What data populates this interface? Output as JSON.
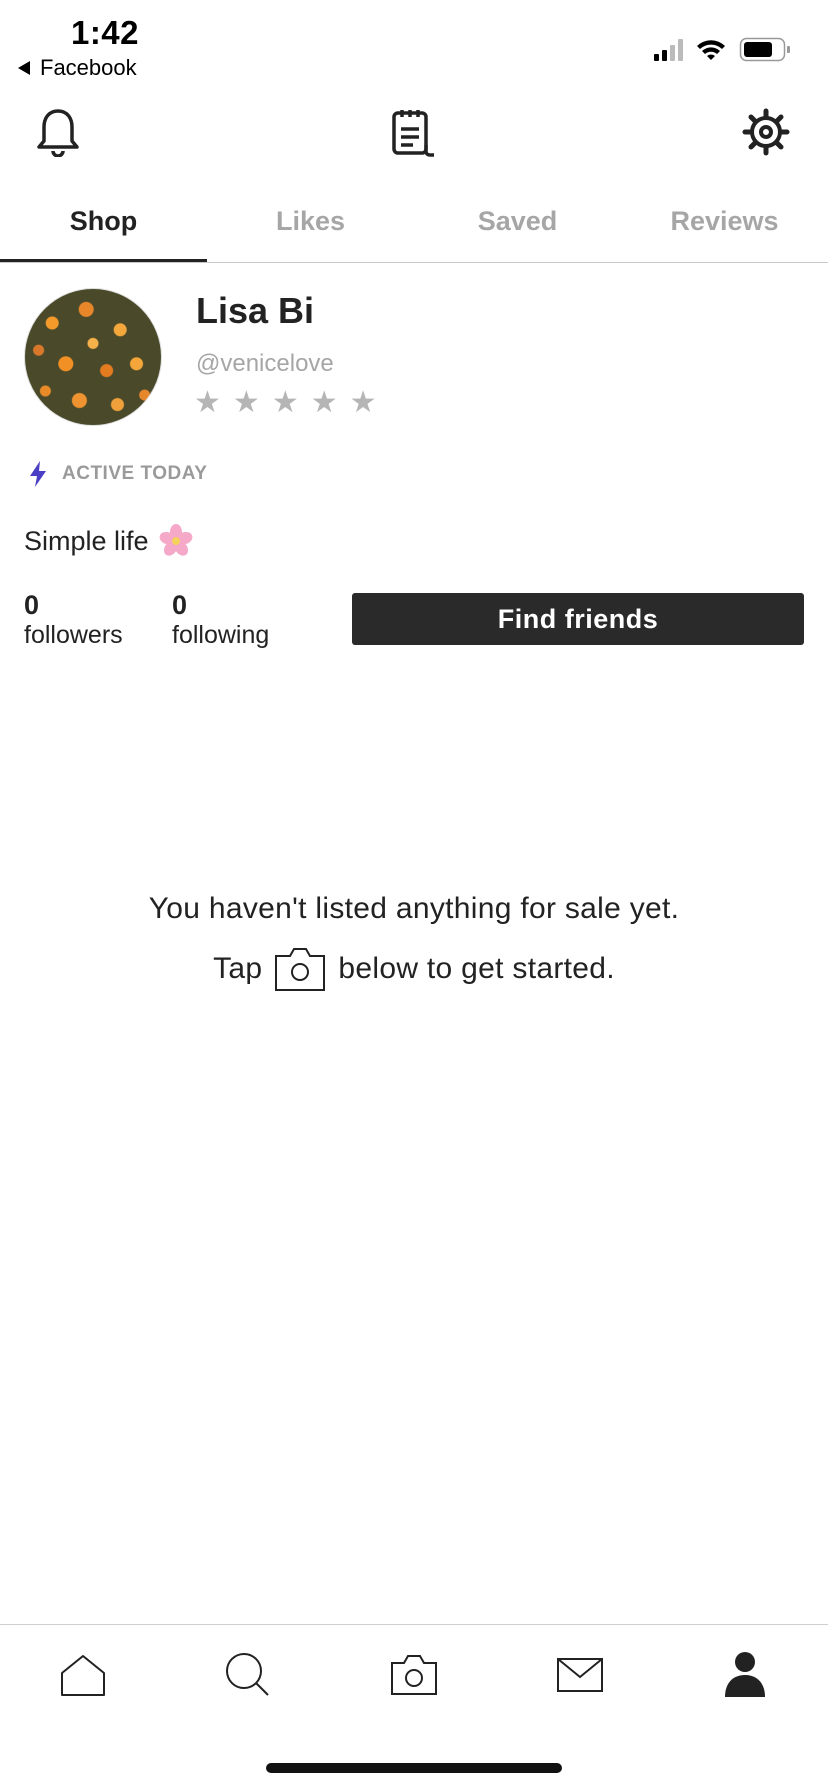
{
  "status_bar": {
    "time": "1:42",
    "back_label": "Facebook"
  },
  "header": {
    "icons": [
      "bell-icon",
      "receipt-icon",
      "gear-icon"
    ]
  },
  "tabs": [
    {
      "label": "Shop",
      "active": true
    },
    {
      "label": "Likes",
      "active": false
    },
    {
      "label": "Saved",
      "active": false
    },
    {
      "label": "Reviews",
      "active": false
    }
  ],
  "profile": {
    "name": "Lisa Bi",
    "handle": "@venicelove",
    "rating_stars": 0,
    "rating_max": 5,
    "active_status": "ACTIVE TODAY",
    "bio": "Simple life",
    "followers_count": "0",
    "followers_label": "followers",
    "following_count": "0",
    "following_label": "following",
    "find_friends_label": "Find friends"
  },
  "empty_state": {
    "line1": "You haven't listed anything for sale yet.",
    "line2_prefix": "Tap",
    "line2_suffix": "below to get started."
  },
  "bottom_nav": {
    "items": [
      "home-icon",
      "search-icon",
      "camera-icon",
      "mail-icon",
      "profile-icon"
    ],
    "active": "profile-icon"
  },
  "colors": {
    "accent_bolt": "#4a3fc4",
    "button_bg": "#2a2a2a",
    "muted_text": "#a6a6a6"
  }
}
